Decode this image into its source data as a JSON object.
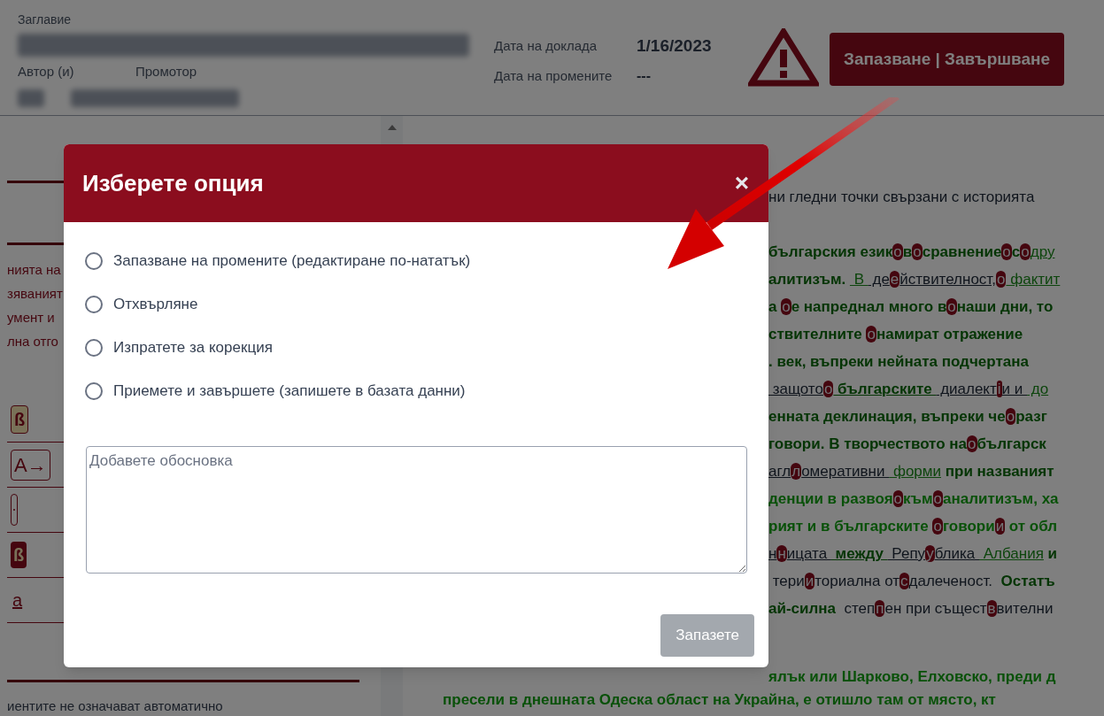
{
  "header": {
    "title_label": "Заглавие",
    "author_label": "Автор (и)",
    "promoter_label": "Промотор",
    "report_date_label": "Дата на доклада",
    "report_date": "1/16/2023",
    "changes_date_label": "Дата на промените",
    "changes_date": "---",
    "finish_button": "Запазване | Завършване"
  },
  "left_panel": {
    "text_fragments": [
      "нията на",
      "зяваният",
      "умент и",
      "лна отго"
    ],
    "tools": [
      {
        "kind": "badge-light",
        "label": "ß"
      },
      {
        "kind": "outline",
        "label": "A→"
      },
      {
        "kind": "pill"
      },
      {
        "kind": "badge-dark",
        "label": "ß"
      },
      {
        "kind": "underline",
        "label": "a"
      }
    ],
    "footer_text": "иентите не означават автоматично"
  },
  "document": {
    "paragraphs": [
      {
        "lines": [
          {
            "kind": "beside",
            "segments": [
              {
                "kind": "plain",
                "text": "ни гледни точки свързани с историята"
              }
            ]
          }
        ]
      },
      {
        "lines": [
          {
            "kind": "beside",
            "segments": [
              {
                "kind": "bold",
                "text": "българския език"
              },
              {
                "kind": "mark",
                "text": "о"
              },
              {
                "kind": "bold",
                "text": "в"
              },
              {
                "kind": "mark",
                "text": "о"
              },
              {
                "kind": "bold",
                "text": "сравнение"
              },
              {
                "kind": "mark",
                "text": "о"
              },
              {
                "kind": "bold",
                "text": "с"
              },
              {
                "kind": "mark",
                "text": "о"
              },
              {
                "kind": "link",
                "text": "дру"
              }
            ]
          },
          {
            "kind": "beside",
            "segments": [
              {
                "kind": "bold",
                "text": "алитизъм. "
              },
              {
                "kind": "link",
                "text": " В "
              },
              {
                "kind": "dark-link",
                "text": " де"
              },
              {
                "kind": "mark",
                "text": "е"
              },
              {
                "kind": "dark-link",
                "text": "йствителност,"
              },
              {
                "kind": "mark",
                "text": "о"
              },
              {
                "kind": "link",
                "text": " фактит"
              }
            ]
          },
          {
            "kind": "beside",
            "segments": [
              {
                "kind": "bold",
                "text": "а "
              },
              {
                "kind": "mark",
                "text": "о"
              },
              {
                "kind": "bold",
                "text": "е напреднал много в"
              },
              {
                "kind": "mark",
                "text": "о"
              },
              {
                "kind": "bold",
                "text": "наши дни, то"
              }
            ]
          },
          {
            "kind": "beside",
            "segments": [
              {
                "kind": "bold",
                "text": "ствителните "
              },
              {
                "kind": "mark",
                "text": "о"
              },
              {
                "kind": "bold",
                "text": "намират отражение"
              }
            ]
          },
          {
            "kind": "beside",
            "segments": [
              {
                "kind": "bold",
                "text": ". век, въпреки нейната подчертана"
              }
            ]
          },
          {
            "kind": "beside",
            "segments": [
              {
                "kind": "dark-link",
                "text": " защото"
              },
              {
                "kind": "mark",
                "text": "о"
              },
              {
                "kind": "bold-link",
                "text": " българските "
              },
              {
                "kind": "dark-link",
                "text": " диалект"
              },
              {
                "kind": "mark",
                "text": "і"
              },
              {
                "kind": "dark-link",
                "text": "и и "
              },
              {
                "kind": "link",
                "text": " до"
              }
            ]
          },
          {
            "kind": "beside",
            "segments": [
              {
                "kind": "bold",
                "text": "енната деклинация, въпреки че"
              },
              {
                "kind": "mark",
                "text": "о"
              },
              {
                "kind": "bold",
                "text": "разг"
              }
            ]
          },
          {
            "kind": "beside",
            "segments": [
              {
                "kind": "bold",
                "text": "говори. В творчеството на"
              },
              {
                "kind": "mark",
                "text": "о"
              },
              {
                "kind": "bold",
                "text": "българск"
              }
            ]
          },
          {
            "kind": "beside",
            "segments": [
              {
                "kind": "dark-link",
                "text": "агл"
              },
              {
                "kind": "mark",
                "text": "л"
              },
              {
                "kind": "dark-link",
                "text": "омеративни "
              },
              {
                "kind": "link",
                "text": " форми"
              },
              {
                "kind": "bold",
                "text": " при названият"
              }
            ]
          },
          {
            "kind": "beside",
            "segments": [
              {
                "kind": "bright",
                "text": "денции в развоя"
              },
              {
                "kind": "mark",
                "text": "о"
              },
              {
                "kind": "bright",
                "text": "към"
              },
              {
                "kind": "mark",
                "text": "о"
              },
              {
                "kind": "bright",
                "text": "аналитизъм, ха"
              }
            ]
          },
          {
            "kind": "beside",
            "segments": [
              {
                "kind": "bright",
                "text": "рият и в българските "
              },
              {
                "kind": "mark",
                "text": "о"
              },
              {
                "kind": "bright",
                "text": "говори"
              },
              {
                "kind": "mark",
                "text": "и"
              },
              {
                "kind": "bright",
                "text": " от обл"
              }
            ]
          },
          {
            "kind": "beside",
            "segments": [
              {
                "kind": "dark-link",
                "text": "н"
              },
              {
                "kind": "mark",
                "text": "н"
              },
              {
                "kind": "dark-link",
                "text": "ицата "
              },
              {
                "kind": "bold-link",
                "text": " между "
              },
              {
                "kind": "dark-link",
                "text": " Репу"
              },
              {
                "kind": "mark",
                "text": "у"
              },
              {
                "kind": "dark-link",
                "text": "блика "
              },
              {
                "kind": "link",
                "text": " Албания"
              },
              {
                "kind": "bold",
                "text": " и"
              }
            ]
          },
          {
            "kind": "beside",
            "segments": [
              {
                "kind": "plain",
                "text": " тери"
              },
              {
                "kind": "mark",
                "text": "и"
              },
              {
                "kind": "plain",
                "text": "ториална от"
              },
              {
                "kind": "mark",
                "text": "с"
              },
              {
                "kind": "plain",
                "text": "далеченост. "
              },
              {
                "kind": "bold",
                "text": " Остатъ"
              }
            ]
          },
          {
            "kind": "beside",
            "segments": [
              {
                "kind": "bold",
                "text": "ай-силна "
              },
              {
                "kind": "plain",
                "text": " степ"
              },
              {
                "kind": "mark",
                "text": "п"
              },
              {
                "kind": "plain",
                "text": "ен при същест"
              },
              {
                "kind": "mark",
                "text": "в"
              },
              {
                "kind": "plain",
                "text": "вителни"
              }
            ]
          }
        ]
      },
      {
        "lines": [
          {
            "kind": "beside",
            "segments": [
              {
                "kind": "bright",
                "text": "ялък или Шарково, Елховско, преди д"
              }
            ]
          },
          {
            "kind": "full",
            "segments": [
              {
                "kind": "bright",
                "text": "пресели в днешната Одеска област на Украйна, е отишло там от място, кт"
              }
            ]
          }
        ]
      }
    ]
  },
  "modal": {
    "title": "Изберете опция",
    "close": "×",
    "options": [
      {
        "label": "Запазване на промените (редактиране по-нататък)",
        "selected": false
      },
      {
        "label": "Отхвърляне",
        "selected": false
      },
      {
        "label": "Изпратете за корекция",
        "selected": false
      },
      {
        "label": "Приемете и завършете (запишете в базата данни)",
        "selected": false
      }
    ],
    "reason_placeholder": "Добавете обосновка",
    "save_button": "Запазете",
    "save_disabled": true
  }
}
